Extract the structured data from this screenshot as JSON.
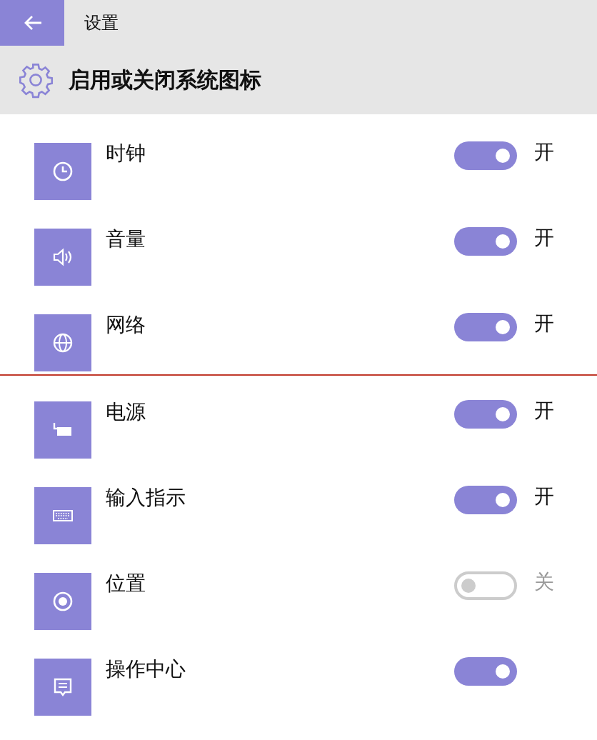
{
  "window": {
    "title": "设置"
  },
  "header": {
    "title": "启用或关闭系统图标"
  },
  "items": [
    {
      "label": "时钟",
      "on": true,
      "state_text": "开"
    },
    {
      "label": "音量",
      "on": true,
      "state_text": "开"
    },
    {
      "label": "网络",
      "on": true,
      "state_text": "开"
    },
    {
      "label": "电源",
      "on": true,
      "state_text": "开"
    },
    {
      "label": "输入指示",
      "on": true,
      "state_text": "开"
    },
    {
      "label": "位置",
      "on": false,
      "state_text": "关"
    },
    {
      "label": "操作中心",
      "on": true
    }
  ]
}
